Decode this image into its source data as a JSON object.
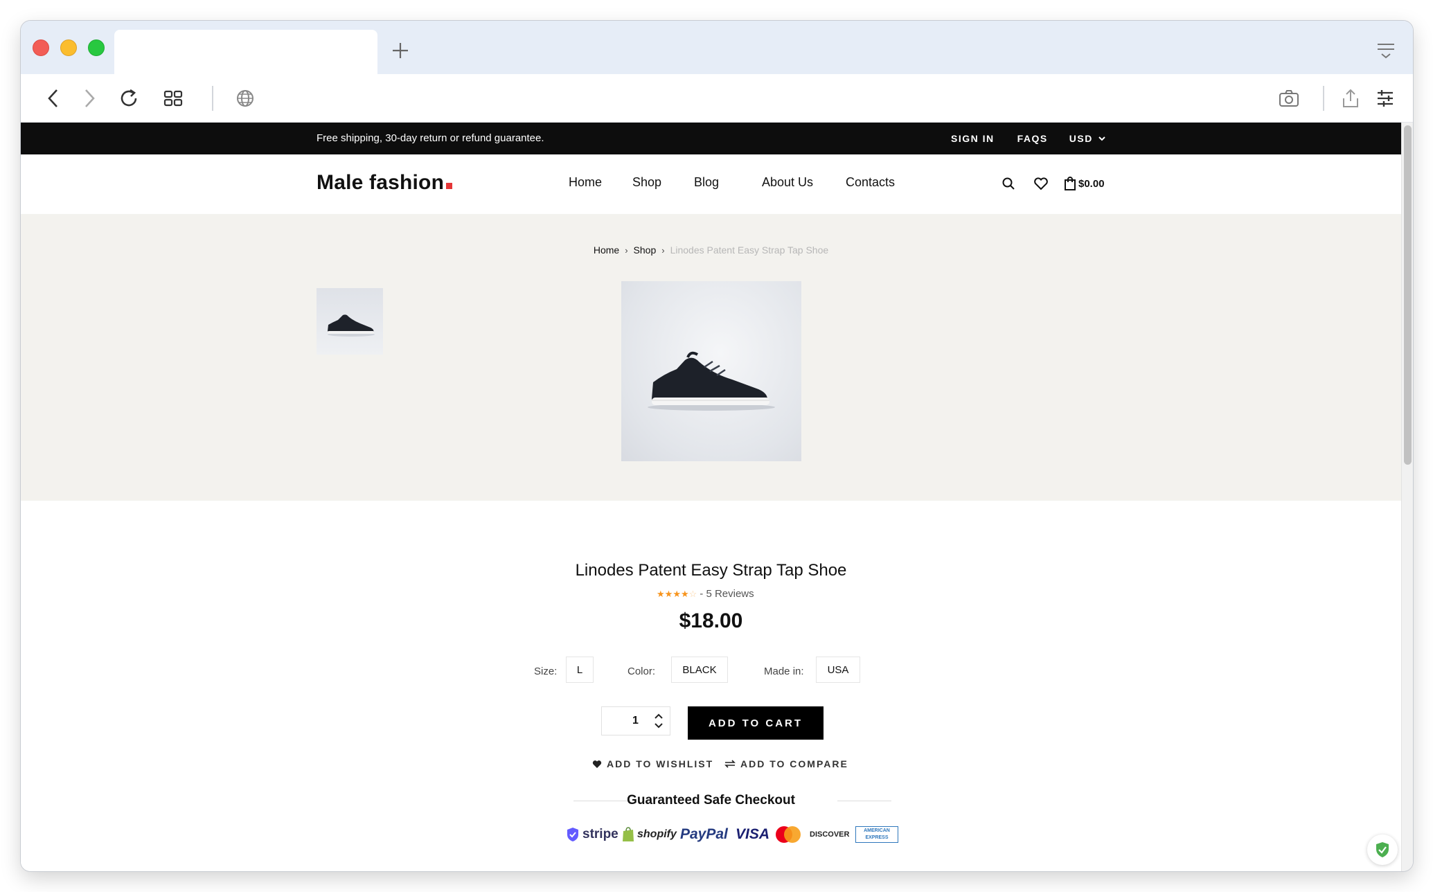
{
  "browser": {
    "icons": {
      "back": "chevron-left-icon",
      "forward": "chevron-right-icon",
      "reload": "reload-icon",
      "tabs_grid": "grid-icon",
      "site_info": "globe-icon",
      "screenshot": "camera-icon",
      "share": "share-icon",
      "settings": "sliders-icon",
      "new_tab": "plus-icon",
      "tab_menu": "menu-icon"
    }
  },
  "topbar": {
    "promo": "Free shipping, 30-day return or refund guarantee.",
    "sign_in": "SIGN IN",
    "faqs": "FAQS",
    "currency": "USD"
  },
  "header": {
    "logo": "Male fashion",
    "nav": [
      "Home",
      "Shop",
      "Blog",
      "About Us",
      "Contacts"
    ],
    "cart_total": "$0.00"
  },
  "breadcrumb": {
    "home": "Home",
    "shop": "Shop",
    "current": "Linodes Patent Easy Strap Tap Shoe"
  },
  "product": {
    "title": "Linodes Patent Easy Strap Tap Shoe",
    "rating": 4,
    "rating_max": 5,
    "reviews": "- 5 Reviews",
    "price": "$18.00",
    "size_label": "Size:",
    "size_value": "L",
    "color_label": "Color:",
    "color_value": "BLACK",
    "made_label": "Made in:",
    "made_value": "USA",
    "quantity": "1",
    "add_to_cart": "ADD TO CART",
    "add_to_wishlist": "ADD TO WISHLIST",
    "add_to_compare": "ADD TO COMPARE"
  },
  "checkout": {
    "title": "Guaranteed Safe Checkout",
    "payments": [
      "stripe",
      "shopify",
      "PayPal",
      "VISA",
      "MasterCard",
      "DISCOVER",
      "AMERICAN EXPRESS"
    ]
  },
  "colors": {
    "accent_red": "#e53637",
    "star_orange": "#f7941d",
    "topbar_bg": "#0d0d0d",
    "hero_bg": "#f3f2ee"
  }
}
